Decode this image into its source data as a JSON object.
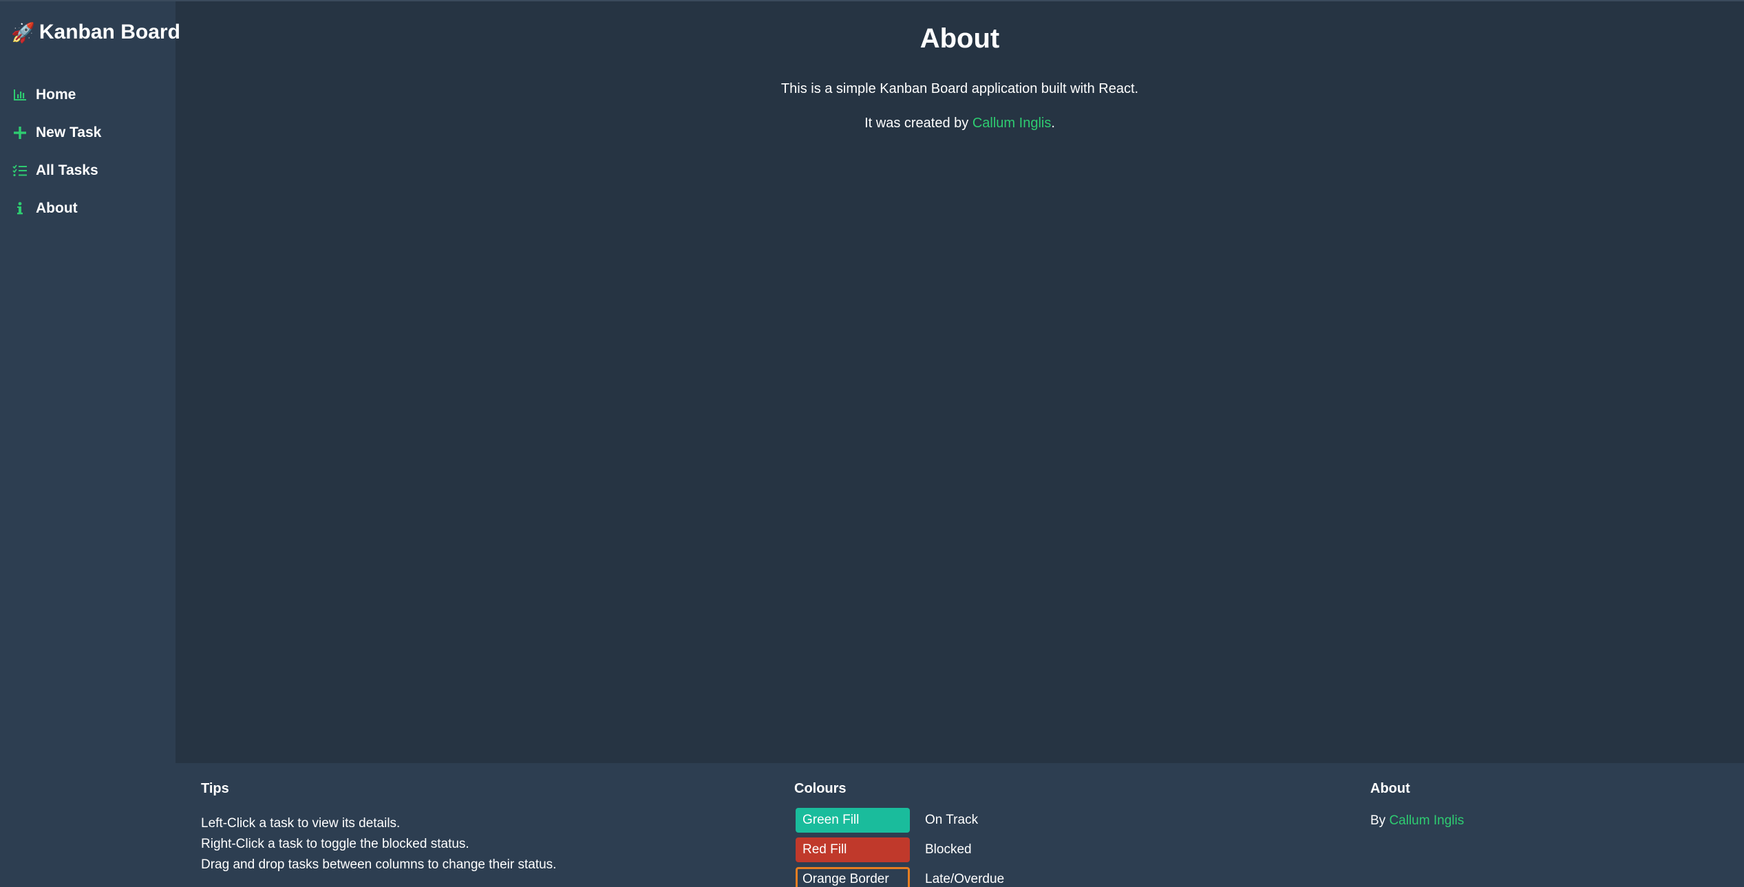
{
  "sidebar": {
    "brand_icon": "🚀",
    "brand": "Kanban Board",
    "items": [
      {
        "label": "Home",
        "icon": "bar-chart-icon"
      },
      {
        "label": "New Task",
        "icon": "plus-icon"
      },
      {
        "label": "All Tasks",
        "icon": "checklist-icon"
      },
      {
        "label": "About",
        "icon": "info-icon"
      }
    ]
  },
  "main": {
    "title": "About",
    "description": "This is a simple Kanban Board application built with React.",
    "created_prefix": "It was created by ",
    "author": "Callum Inglis",
    "created_suffix": "."
  },
  "footer": {
    "tips": {
      "heading": "Tips",
      "lines": [
        "Left-Click a task to view its details.",
        "Right-Click a task to toggle the blocked status.",
        "Drag and drop tasks between columns to change their status."
      ]
    },
    "colours": {
      "heading": "Colours",
      "rows": [
        {
          "swatch": "Green Fill",
          "meaning": "On Track",
          "color": "#1abc9c"
        },
        {
          "swatch": "Red Fill",
          "meaning": "Blocked",
          "color": "#c0392b"
        },
        {
          "swatch": "Orange Border",
          "meaning": "Late/Overdue",
          "color": "#e67e22"
        }
      ]
    },
    "about": {
      "heading": "About",
      "by_prefix": "By ",
      "author": "Callum Inglis"
    }
  },
  "colors": {
    "accent": "#2ecc71",
    "background": "#263443",
    "sidebar": "#2d3e51"
  }
}
